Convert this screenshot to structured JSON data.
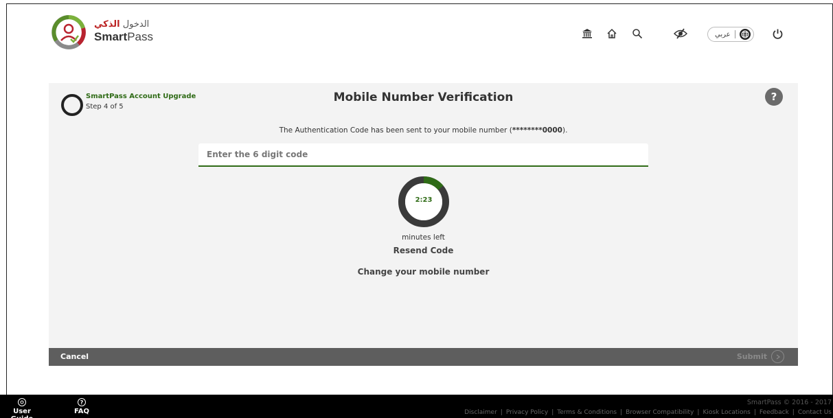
{
  "header": {
    "logo_arabic_prefix": "الدخول",
    "logo_arabic_bold": "الذكي",
    "logo_en_bold": "Smart",
    "logo_en_rest": "Pass",
    "icons": [
      "institution-icon",
      "home-icon",
      "search-icon",
      "eye-slash-icon",
      "globe-icon",
      "power-icon"
    ],
    "language_label": "عربي"
  },
  "wizard": {
    "account_title": "SmartPass Account Upgrade",
    "step": "Step 4 of 5",
    "page_title": "Mobile Number Verification",
    "help_label": "?"
  },
  "verification": {
    "message_prefix": "The Authentication Code has been sent to your mobile number (",
    "masked_number": "********0000",
    "message_suffix": ").",
    "code_placeholder": "Enter the 6 digit code",
    "timer_value": "2:23",
    "timer_progress": 0.14,
    "minutes_left_label": "minutes left",
    "resend_label": "Resend Code",
    "change_number_label": "Change your mobile number"
  },
  "actions": {
    "cancel_label": "Cancel",
    "submit_label": "Submit"
  },
  "footer": {
    "user_guide_label": "User Guide",
    "faq_label": "FAQ",
    "copyright": "SmartPass © 2016 - 2017",
    "links": [
      "Disclaimer",
      "Privacy Policy",
      "Terms & Conditions",
      "Browser Compatibility",
      "Kiosk Locations",
      "Feedback",
      "Contact Us"
    ]
  },
  "colors": {
    "accent_green": "#2f6b16",
    "action_bar": "#5e5e5e",
    "panel_bg": "#f3f3f3",
    "footer_bg": "#000000"
  }
}
